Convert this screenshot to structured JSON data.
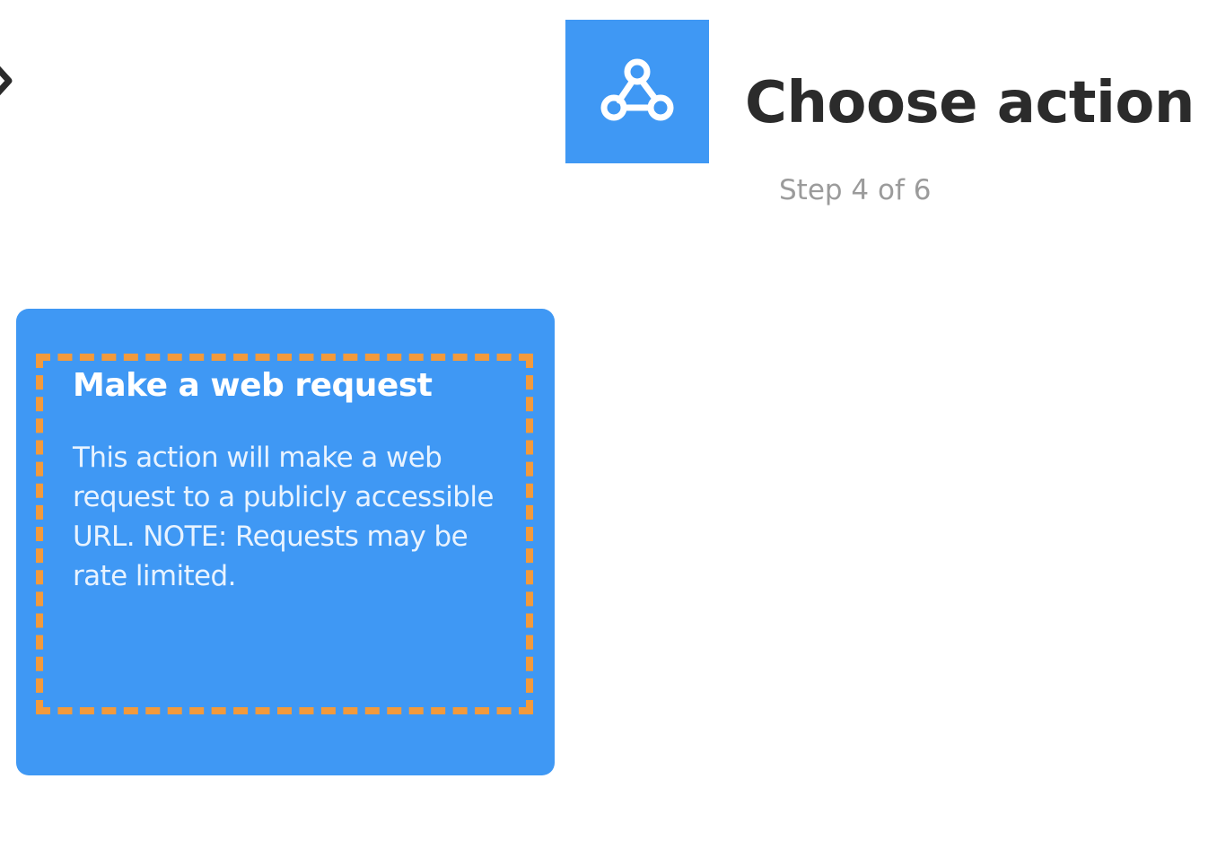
{
  "header": {
    "title": "Choose action",
    "step": "Step 4 of 6",
    "service_icon": "webhooks-icon",
    "back_icon": "back-arrow-icon"
  },
  "action_card": {
    "title": "Make a web request",
    "description": "This action will make a web request to a publicly accessible URL. NOTE: Requests may be rate limited."
  },
  "colors": {
    "card_background": "#3f98f4",
    "highlight_border": "#f29a3c",
    "title_text": "#2b2b2b",
    "step_text": "#9b9b9b"
  }
}
